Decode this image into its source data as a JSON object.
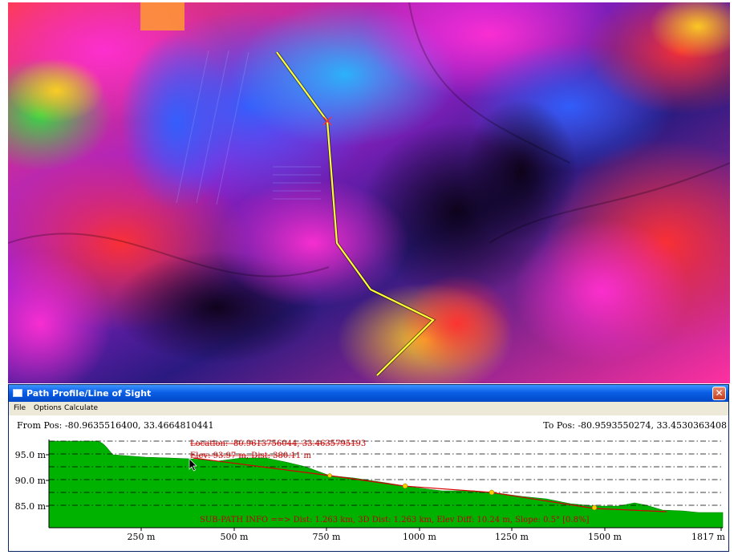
{
  "window": {
    "title": "Path Profile/Line of Sight",
    "close_glyph": "✕"
  },
  "menu": [
    "File",
    "Options",
    "Calculate"
  ],
  "positions": {
    "from": "From Pos: -80.9635516400, 33.4664810441",
    "to": "To Pos: -80.9593550274, 33.4530363408"
  },
  "profile": {
    "y_ticks": [
      "95.0 m",
      "90.0 m",
      "85.0 m"
    ],
    "x_ticks": [
      "250 m",
      "500 m",
      "750 m",
      "1000 m",
      "1250 m",
      "1500 m",
      "1817 m"
    ],
    "cursor_location": "Location: -80.9613756044, 33.4635795193",
    "cursor_elev": "Elev: 93.97 m, Dist: 380.11 m",
    "subpath_info": "SUB-PATH INFO ==> Dist: 1.263 km, 3D Dist: 1.263 km, Elev Diff: 10.24 m, Slope: 0.5° [0.8%]"
  },
  "colors": {
    "terrain_fill": "#00b200",
    "path_line": "#d40000",
    "annotation_text": "#c00000",
    "map_path": "#ffff33",
    "vertex_marker": "#ffcc00"
  }
}
